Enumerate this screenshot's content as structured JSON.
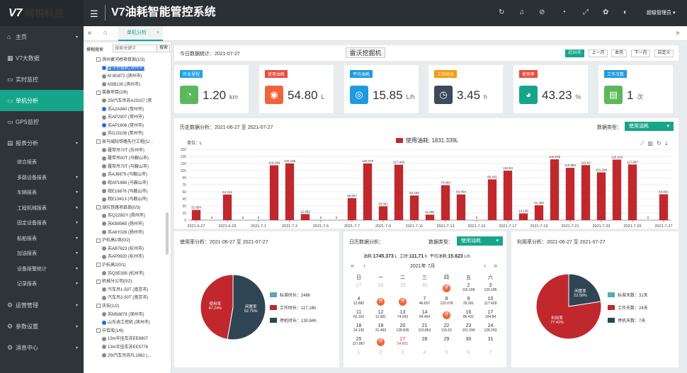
{
  "header": {
    "logo_v": "V7",
    "logo_name": "网锐科技",
    "title": "V7油耗智能管控系统",
    "user": "超级管理员 ▾"
  },
  "sidebar": [
    {
      "label": "主页",
      "icon": "⌂",
      "arrow": "▾",
      "active": false
    },
    {
      "label": "V7大数据",
      "icon": "▦",
      "arrow": "",
      "active": false
    },
    {
      "label": "实时监控",
      "icon": "▭",
      "arrow": "",
      "active": false
    },
    {
      "label": "单机分析",
      "icon": "▭",
      "arrow": "",
      "active": true
    },
    {
      "label": "GPS监控",
      "icon": "▭",
      "arrow": "",
      "active": false
    },
    {
      "label": "报表分析",
      "icon": "▤",
      "arrow": "▾",
      "active": false
    }
  ],
  "sidebar_sub": [
    {
      "label": "综合报表",
      "arrow": ""
    },
    {
      "label": "多路设备报表",
      "arrow": "▾"
    },
    {
      "label": "车辆报表",
      "arrow": "▾"
    },
    {
      "label": "工程机械报表",
      "arrow": "▾"
    },
    {
      "label": "固定设备报表",
      "arrow": "▾"
    },
    {
      "label": "船舶报表",
      "arrow": "▾"
    },
    {
      "label": "加油报表",
      "arrow": "▾"
    },
    {
      "label": "设备报警统计",
      "arrow": "▾"
    },
    {
      "label": "记录报表",
      "arrow": "▾"
    }
  ],
  "sidebar_bottom": [
    {
      "label": "运营管理",
      "icon": "⚙",
      "arrow": "▾"
    },
    {
      "label": "参数设置",
      "icon": "⚙",
      "arrow": "▾"
    },
    {
      "label": "消息中心",
      "icon": "⚙",
      "arrow": "▾"
    }
  ],
  "tab": {
    "label": "单机分析",
    "close": "×"
  },
  "tree": {
    "search_label": "模糊搜索",
    "placeholder": "搜索关键字",
    "btn": "搜索",
    "rows": [
      "滨州黄河桥项目部(1/3)",
      "雷沃挖掘机(滨州市)",
      "M 8G872 (滨州市)",
      "M3B130 (滨州市)",
      "莱泰项目(2/6)",
      "25t汽车吊苏AJ3107 (常",
      "苏A2A940 (常州市)",
      "苏AP2907 (常州市)",
      "苏AP1606 (常州市)",
      "苏GJ3106 (常州市)",
      "吴马城际铁路先行工程(1/...",
      "履带吊70T (苏州市)",
      "履带吊50T (马鞍山市)",
      "履带吊70T (马鞍山市)",
      "苏AJ6879 (马鞍山市)",
      "皖AP1666 (马鞍山市)",
      "皖E16876 (马鞍山市)",
      "皖E19413 (马鞍山市)",
      "湖坑铁路项目部(0/3)",
      "苏Q228GY (扬州市)",
      "苏KB9965 (扬州市)",
      "苏A6Y026 (扬州市)",
      "沪杭高1项(0/2)",
      "苏AB7623 (杭州市)",
      "苏AP9920 (杭州市)",
      "沪杭高2(0/1)",
      "苏Q3E395 (杭州市)",
      "机械分公司(0/2)",
      "汽车吊1-50T (南京市)",
      "汽车吊2-50T (南京市)",
      "庆安(1/2)",
      "苏M58878 (滨州市)",
      "山东迪工挖机 (滨州市)",
      "中百库(1/6)",
      "13m半挂车苏EE6907",
      "13m半挂车苏EE5776",
      "25t汽车吊苏FL1962 (..."
    ]
  },
  "stats": {
    "date_label": "今日数据统计：2021-07-27",
    "machine": "雷沃挖掘机",
    "range_btns": [
      "近30天",
      "上一月",
      "本月",
      "下一月",
      "自定义"
    ],
    "cards": [
      {
        "label": "作业里程",
        "value": "1.20",
        "unit": "km",
        "icon": "◔",
        "color": "#5cb85c",
        "lbcolor": "#1ea1ea"
      },
      {
        "label": "使用油耗",
        "value": "54.80",
        "unit": "L",
        "icon": "◉",
        "color": "#f0643c",
        "lbcolor": "#e74c3c"
      },
      {
        "label": "平均油耗",
        "value": "15.85",
        "unit": "L/h",
        "icon": "◎",
        "color": "#1e9be0",
        "lbcolor": "#1e9be0"
      },
      {
        "label": "工作时长",
        "value": "3.45",
        "unit": "h",
        "icon": "◷",
        "color": "#3c4a5a",
        "lbcolor": "#f39c12"
      },
      {
        "label": "使用率",
        "value": "43.23",
        "unit": "%",
        "icon": "◕",
        "color": "#17a589",
        "lbcolor": "#e74c3c"
      },
      {
        "label": "工作次数",
        "value": "1",
        "unit": "次",
        "icon": "▤",
        "color": "#5cb85c",
        "lbcolor": "#1e9be0"
      }
    ]
  },
  "history": {
    "title": "历史数据分析：2021-06-27 至 2021-07-27",
    "type_label": "数据类型：",
    "type_value": "使用油耗",
    "unit_label": "单位：L",
    "legend": "使用油耗: 1831.339L"
  },
  "chart_data": [
    {
      "type": "bar",
      "ylim": [
        0,
        150
      ],
      "yticks": [
        0,
        15,
        30,
        45,
        60,
        75,
        90,
        105,
        120,
        135,
        150
      ],
      "legend": [
        "使用油耗: 1831.339L"
      ],
      "color": "#c0282d",
      "grid": true,
      "categories": [
        "2021-6-27",
        "2021-6-28",
        "2021-6-29",
        "2021-6-30",
        "2021-7-1",
        "2021-7-2",
        "2021-7-3",
        "2021-7-4",
        "2021-7-5",
        "2021-7-6",
        "2021-7-7",
        "2021-7-8",
        "2021-7-9",
        "2021-7-10",
        "2021-7-11",
        "2021-7-12",
        "2021-7-13",
        "2021-7-14",
        "2021-7-15",
        "2021-7-16",
        "2021-7-17",
        "2021-7-18",
        "2021-7-19",
        "2021-7-20",
        "2021-7-21",
        "2021-7-22",
        "2021-7-23",
        "2021-7-24",
        "2021-7-25",
        "2021-7-26",
        "2021-7-27"
      ],
      "values": [
        21.654,
        0,
        54.312,
        0,
        0,
        116.199,
        120.185,
        12.882,
        0,
        0,
        46.657,
        120.078,
        29.361,
        117.428,
        52.162,
        11.681,
        74.093,
        54.454,
        0,
        86.431,
        104.84,
        14.136,
        31.463,
        128.835,
        110.853,
        116.62,
        101.294,
        128.203,
        117.867,
        0,
        54.801
      ],
      "labels": [
        "21.654",
        "0",
        "54.312",
        "0",
        "0",
        "116.199",
        "120.185",
        "12.882",
        "0",
        "0",
        "46.657",
        "120.078",
        "29.361",
        "117.428",
        "52.162",
        "11.681",
        "74.093",
        "54.454",
        "0",
        "86.431",
        "104.84",
        "14.136",
        "31.463",
        "128.835",
        "110.853",
        "116.62",
        "101.294",
        "128.203",
        "117.867",
        "0",
        "54.801"
      ],
      "xticks": [
        "2021-6-27",
        "2021-6-29",
        "2021-7-1",
        "2021-7-3",
        "2021-7-5",
        "2021-7-7",
        "2021-7-9",
        "2021-7-11",
        "2021-7-13",
        "2021-7-15",
        "2021-7-17",
        "2021-7-19",
        "2021-7-21",
        "2021-7-23",
        "2021-7-25",
        "2021-7-27"
      ]
    },
    {
      "type": "pie",
      "title": "使用率分析：2021-06-27 至 2021-07-27",
      "slices": [
        {
          "name": "标准时长",
          "value": 248,
          "label": "标准时长：248h",
          "color": "#5ba8ad"
        },
        {
          "name": "工作时长",
          "value": 117.16,
          "label": "工作时长：117.16h",
          "color": "#c0282d"
        },
        {
          "name": "停机时长",
          "value": 130.84,
          "label": "停机时长：130.84h",
          "color": "#2f4554"
        }
      ],
      "inner": [
        {
          "name": "闲置率",
          "pct": "52.76%",
          "value": 52.76,
          "color": "#2f4554"
        },
        {
          "name": "使用率",
          "pct": "47.24%",
          "value": 47.24,
          "color": "#c0282d"
        }
      ]
    },
    {
      "type": "pie",
      "title": "利用率分析：2021-06-27 至 2021-07-27",
      "slices": [
        {
          "name": "标准天数",
          "value": 31,
          "label": "标准天数：31天",
          "color": "#5ba8ad"
        },
        {
          "name": "工作天数",
          "value": 24,
          "label": "工作天数：24天",
          "color": "#c0282d"
        },
        {
          "name": "停机天数",
          "value": 7,
          "label": "停机天数：7天",
          "color": "#2f4554"
        }
      ],
      "inner": [
        {
          "name": "闲置率",
          "pct": "22.58%",
          "value": 22.58,
          "color": "#2f4554"
        },
        {
          "name": "利用率",
          "pct": "77.42%",
          "value": 77.42,
          "color": "#c0282d"
        }
      ]
    }
  ],
  "calendar": {
    "title": "日历数据分析：",
    "type_label": "数据类型：",
    "type_value": "使用油耗",
    "sum_text": "油耗:",
    "sum_val": "1745.373",
    "sum_unit": "L",
    "time_text": "工时:",
    "time_val": "111.71",
    "time_unit": "h",
    "avg_text": "平均油耗:",
    "avg_val": "15.623",
    "avg_unit": "L/h",
    "month": "2021年 7月",
    "weekdays": [
      "日",
      "一",
      "二",
      "三",
      "四",
      "五",
      "六"
    ],
    "weeks": [
      [
        {
          "d": "27",
          "s": "",
          "f": 1
        },
        {
          "d": "28",
          "s": "",
          "f": 1
        },
        {
          "d": "29",
          "s": "",
          "f": 1
        },
        {
          "d": "30",
          "s": "",
          "f": 1
        },
        {
          "d": "",
          "s": "停",
          "c": 1
        },
        {
          "d": "2",
          "s": "116.199"
        },
        {
          "d": "3",
          "s": "120.185"
        }
      ],
      [
        {
          "d": "4",
          "s": "12.882"
        },
        {
          "d": "",
          "s": "停",
          "c": 1
        },
        {
          "d": "",
          "s": "停",
          "c": 1
        },
        {
          "d": "7",
          "s": "46.657"
        },
        {
          "d": "8",
          "s": "120.078"
        },
        {
          "d": "9",
          "s": "29.361"
        },
        {
          "d": "10",
          "s": "117.428"
        }
      ],
      [
        {
          "d": "11",
          "s": "52.162"
        },
        {
          "d": "12",
          "s": "11.681"
        },
        {
          "d": "13",
          "s": "74.093"
        },
        {
          "d": "14",
          "s": "54.454"
        },
        {
          "d": "",
          "s": "停",
          "c": 1
        },
        {
          "d": "16",
          "s": "86.431"
        },
        {
          "d": "17",
          "s": "104.84"
        }
      ],
      [
        {
          "d": "18",
          "s": "14.136"
        },
        {
          "d": "19",
          "s": "31.463"
        },
        {
          "d": "20",
          "s": "128.835"
        },
        {
          "d": "21",
          "s": "110.853"
        },
        {
          "d": "22",
          "s": "116.62"
        },
        {
          "d": "23",
          "s": "101.294"
        },
        {
          "d": "24",
          "s": "128.203"
        }
      ],
      [
        {
          "d": "25",
          "s": "117.867"
        },
        {
          "d": "",
          "s": "停",
          "c": 1
        },
        {
          "d": "27",
          "s": "54.801",
          "r": 1
        },
        {
          "d": "28",
          "s": ""
        },
        {
          "d": "29",
          "s": ""
        },
        {
          "d": "30",
          "s": ""
        },
        {
          "d": "31",
          "s": ""
        }
      ],
      [
        {
          "d": "1",
          "s": "",
          "f": 1
        },
        {
          "d": "2",
          "s": "",
          "f": 1
        },
        {
          "d": "3",
          "s": "",
          "f": 1
        },
        {
          "d": "4",
          "s": "",
          "f": 1
        },
        {
          "d": "5",
          "s": "",
          "f": 1
        },
        {
          "d": "6",
          "s": "",
          "f": 1
        },
        {
          "d": "7",
          "s": "",
          "f": 1
        }
      ]
    ]
  }
}
